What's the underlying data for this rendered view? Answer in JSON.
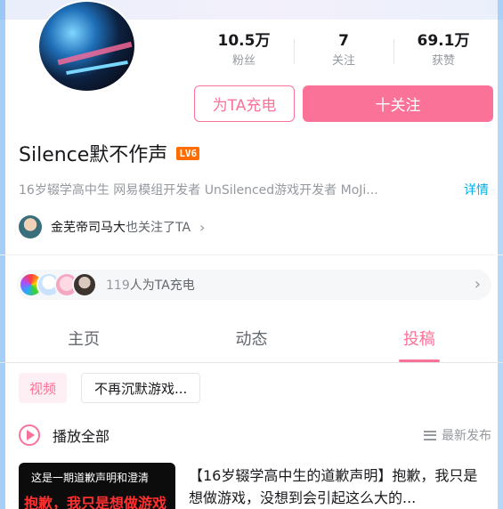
{
  "profile": {
    "username": "Silence默不作声",
    "level": "LV6",
    "bio": "16岁辍学高中生 网易模组开发者 UnSilenced游戏开发者 MoJi...",
    "detail_label": "详情"
  },
  "stats": [
    {
      "value": "10.5万",
      "label": "粉丝"
    },
    {
      "value": "7",
      "label": "关注"
    },
    {
      "value": "69.1万",
      "label": "获赞"
    }
  ],
  "actions": {
    "charge_label": "为TA充电",
    "follow_label": "十关注"
  },
  "also_follow": {
    "name": "金芜帝司马大",
    "suffix": "也关注了TA"
  },
  "charge_bar": {
    "count": "119",
    "text": "人为TA充电"
  },
  "tabs": [
    {
      "label": "主页",
      "active": false
    },
    {
      "label": "动态",
      "active": false
    },
    {
      "label": "投稿",
      "active": true
    }
  ],
  "filters": {
    "type_chip": "视频",
    "series_chip": "不再沉默游戏..."
  },
  "playlist": {
    "play_all": "播放全部",
    "sort_label": "最新发布"
  },
  "video": {
    "thumb_line1": "这是一期道歉声明和澄清",
    "thumb_line2": "抱歉，我只是想做游戏",
    "title": "【16岁辍学高中生的道歉声明】抱歉，我只是想做游戏，没想到会引起这么大的..."
  },
  "colors": {
    "accent": "#fb7299",
    "link": "#00aeec",
    "level": "#ff6c00"
  }
}
